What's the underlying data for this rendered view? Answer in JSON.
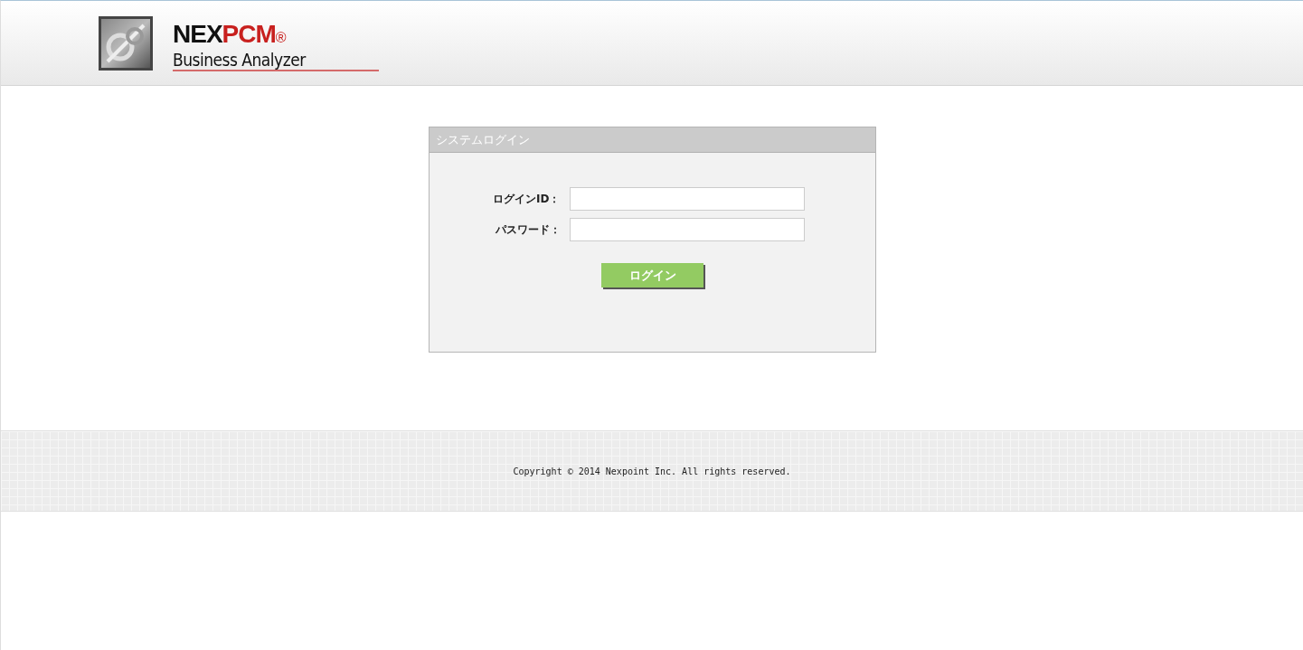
{
  "header": {
    "brand": {
      "first": "NEX",
      "second": "PCM",
      "mark": "®"
    },
    "product": "Business Analyzer"
  },
  "login_panel": {
    "title": "システムログイン",
    "fields": [
      {
        "label": "ログインID："
      },
      {
        "label": "パスワード："
      }
    ],
    "button": "ログイン"
  },
  "footer": {
    "copyright": "Copyright © 2014 Nexpoint Inc. All rights reserved."
  }
}
